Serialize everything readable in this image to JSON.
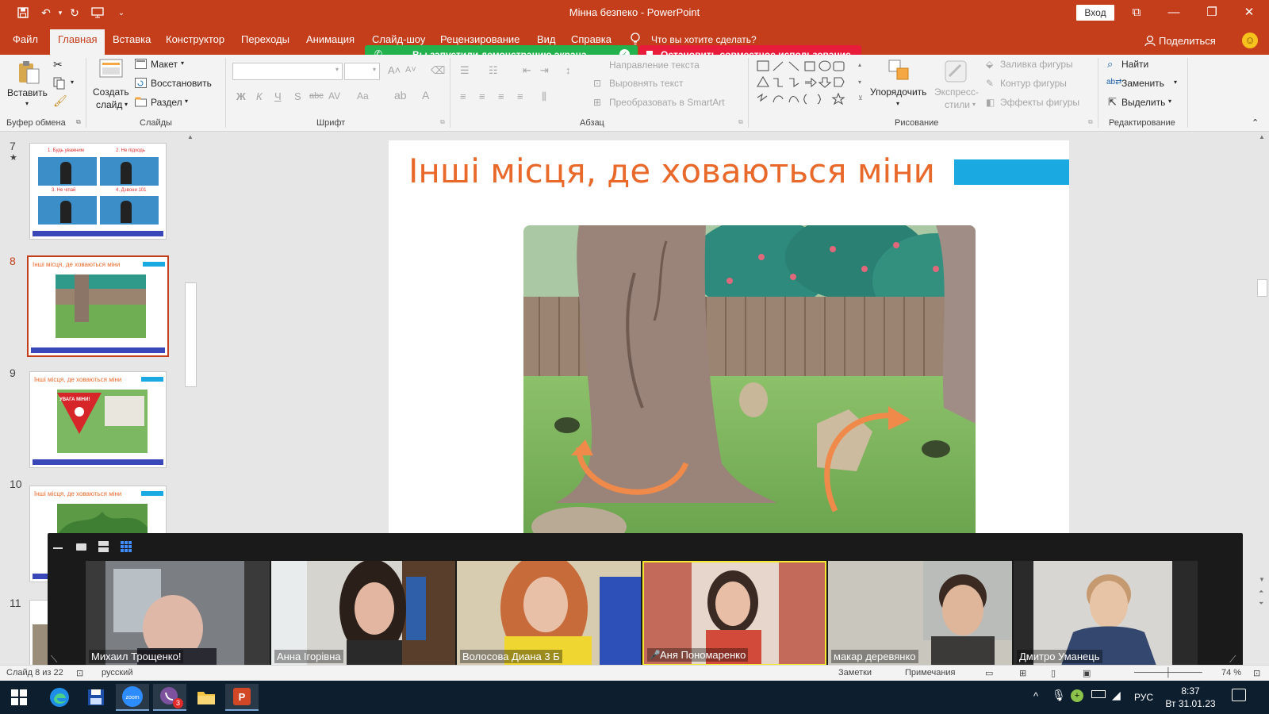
{
  "window": {
    "title": "Мінна безпеко  -  PowerPoint",
    "login": "Вход"
  },
  "tabs": [
    "Файл",
    "Главная",
    "Вставка",
    "Конструктор",
    "Переходы",
    "Анимация",
    "Слайд-шоу",
    "Рецензирование",
    "Вид",
    "Справка"
  ],
  "tellme": "Что вы хотите сделать?",
  "share": "Поделиться",
  "zoom_banners": {
    "sharing": "Вы запустили демонстрацию экрана",
    "stop": "Остановить совместное использование"
  },
  "ribbon": {
    "clipboard": {
      "paste": "Вставить",
      "label": "Буфер обмена"
    },
    "slides": {
      "new_slide_1": "Создать",
      "new_slide_2": "слайд",
      "layout": "Макет",
      "reset": "Восстановить",
      "section": "Раздел",
      "label": "Слайды"
    },
    "font": {
      "label": "Шрифт",
      "b": "Ж",
      "i": "К",
      "u": "Ч",
      "s": "S",
      "strike": "abc",
      "spacing": "AV",
      "case": "Aa",
      "color": "A"
    },
    "paragraph": {
      "label": "Абзац",
      "text_dir": "Направление текста",
      "align_text": "Выровнять текст",
      "smartart": "Преобразовать в SmartArt"
    },
    "drawing": {
      "label": "Рисование",
      "arrange": "Упорядочить",
      "quick_styles_1": "Экспресс-",
      "quick_styles_2": "стили",
      "fill": "Заливка фигуры",
      "outline": "Контур фигуры",
      "effects": "Эффекты фигуры"
    },
    "editing": {
      "label": "Редактирование",
      "find": "Найти",
      "replace": "Заменить",
      "select": "Выделить"
    }
  },
  "thumbnails": [
    {
      "num": "7",
      "star": "★",
      "cap1": "1. Будь уважним",
      "cap2": "2. Не підходь",
      "cap3": "3. Не чіпай",
      "cap4": "4. Дзвони 101"
    },
    {
      "num": "8",
      "title": "Інші місця, де ховаються міни"
    },
    {
      "num": "9",
      "title": "Інші місця, де ховаються міни",
      "sign": "УВАГА МІНИ!"
    },
    {
      "num": "10",
      "title": "Інші місця, де ховаються міни"
    },
    {
      "num": "11"
    }
  ],
  "slide": {
    "title": "Інші місця, де ховаються міни"
  },
  "participants": [
    {
      "name": "Михаил Трощенко!"
    },
    {
      "name": "Анна Ігорівна"
    },
    {
      "name": "Волосова Диана 3 Б"
    },
    {
      "name": "Аня Пономаренко"
    },
    {
      "name": "макар  деревянко"
    },
    {
      "name": "Дмитро Уманець"
    }
  ],
  "statusbar": {
    "slide": "Слайд 8 из 22",
    "lang": "русский",
    "notes": "Заметки",
    "comments": "Примечания",
    "zoom": "74 %"
  },
  "taskbar": {
    "lang": "РУС",
    "time": "8:37",
    "date": "Вт 31.01.23",
    "viber_badge": "3"
  }
}
